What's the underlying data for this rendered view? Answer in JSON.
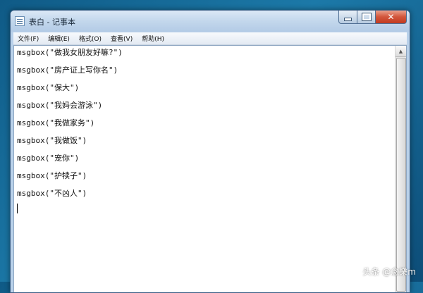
{
  "window": {
    "title": "表白 - 记事本"
  },
  "menu": [
    {
      "label": "文件(F)"
    },
    {
      "label": "编辑(E)"
    },
    {
      "label": "格式(O)"
    },
    {
      "label": "查看(V)"
    },
    {
      "label": "帮助(H)"
    }
  ],
  "document": {
    "lines": [
      "msgbox(\"做我女朋友好嘛?\")",
      "msgbox(\"房产证上写你名\")",
      "msgbox(\"保大\")",
      "msgbox(\"我妈会游泳\")",
      "msgbox(\"我做家务\")",
      "msgbox(\"我做饭\")",
      "msgbox(\"宠你\")",
      "msgbox(\"护犊子\")",
      "msgbox(\"不凶人\")"
    ]
  },
  "watermark": "头条 @念樂m",
  "icons": {
    "app": "notepad-icon",
    "minimize": "minimize-icon",
    "maximize": "maximize-icon",
    "close": "close-icon",
    "scroll_up": "arrow-up-icon"
  },
  "colors": {
    "close_button": "#c23a20",
    "titlebar": "#c3d7ec",
    "desktop": "#1c79a8"
  }
}
